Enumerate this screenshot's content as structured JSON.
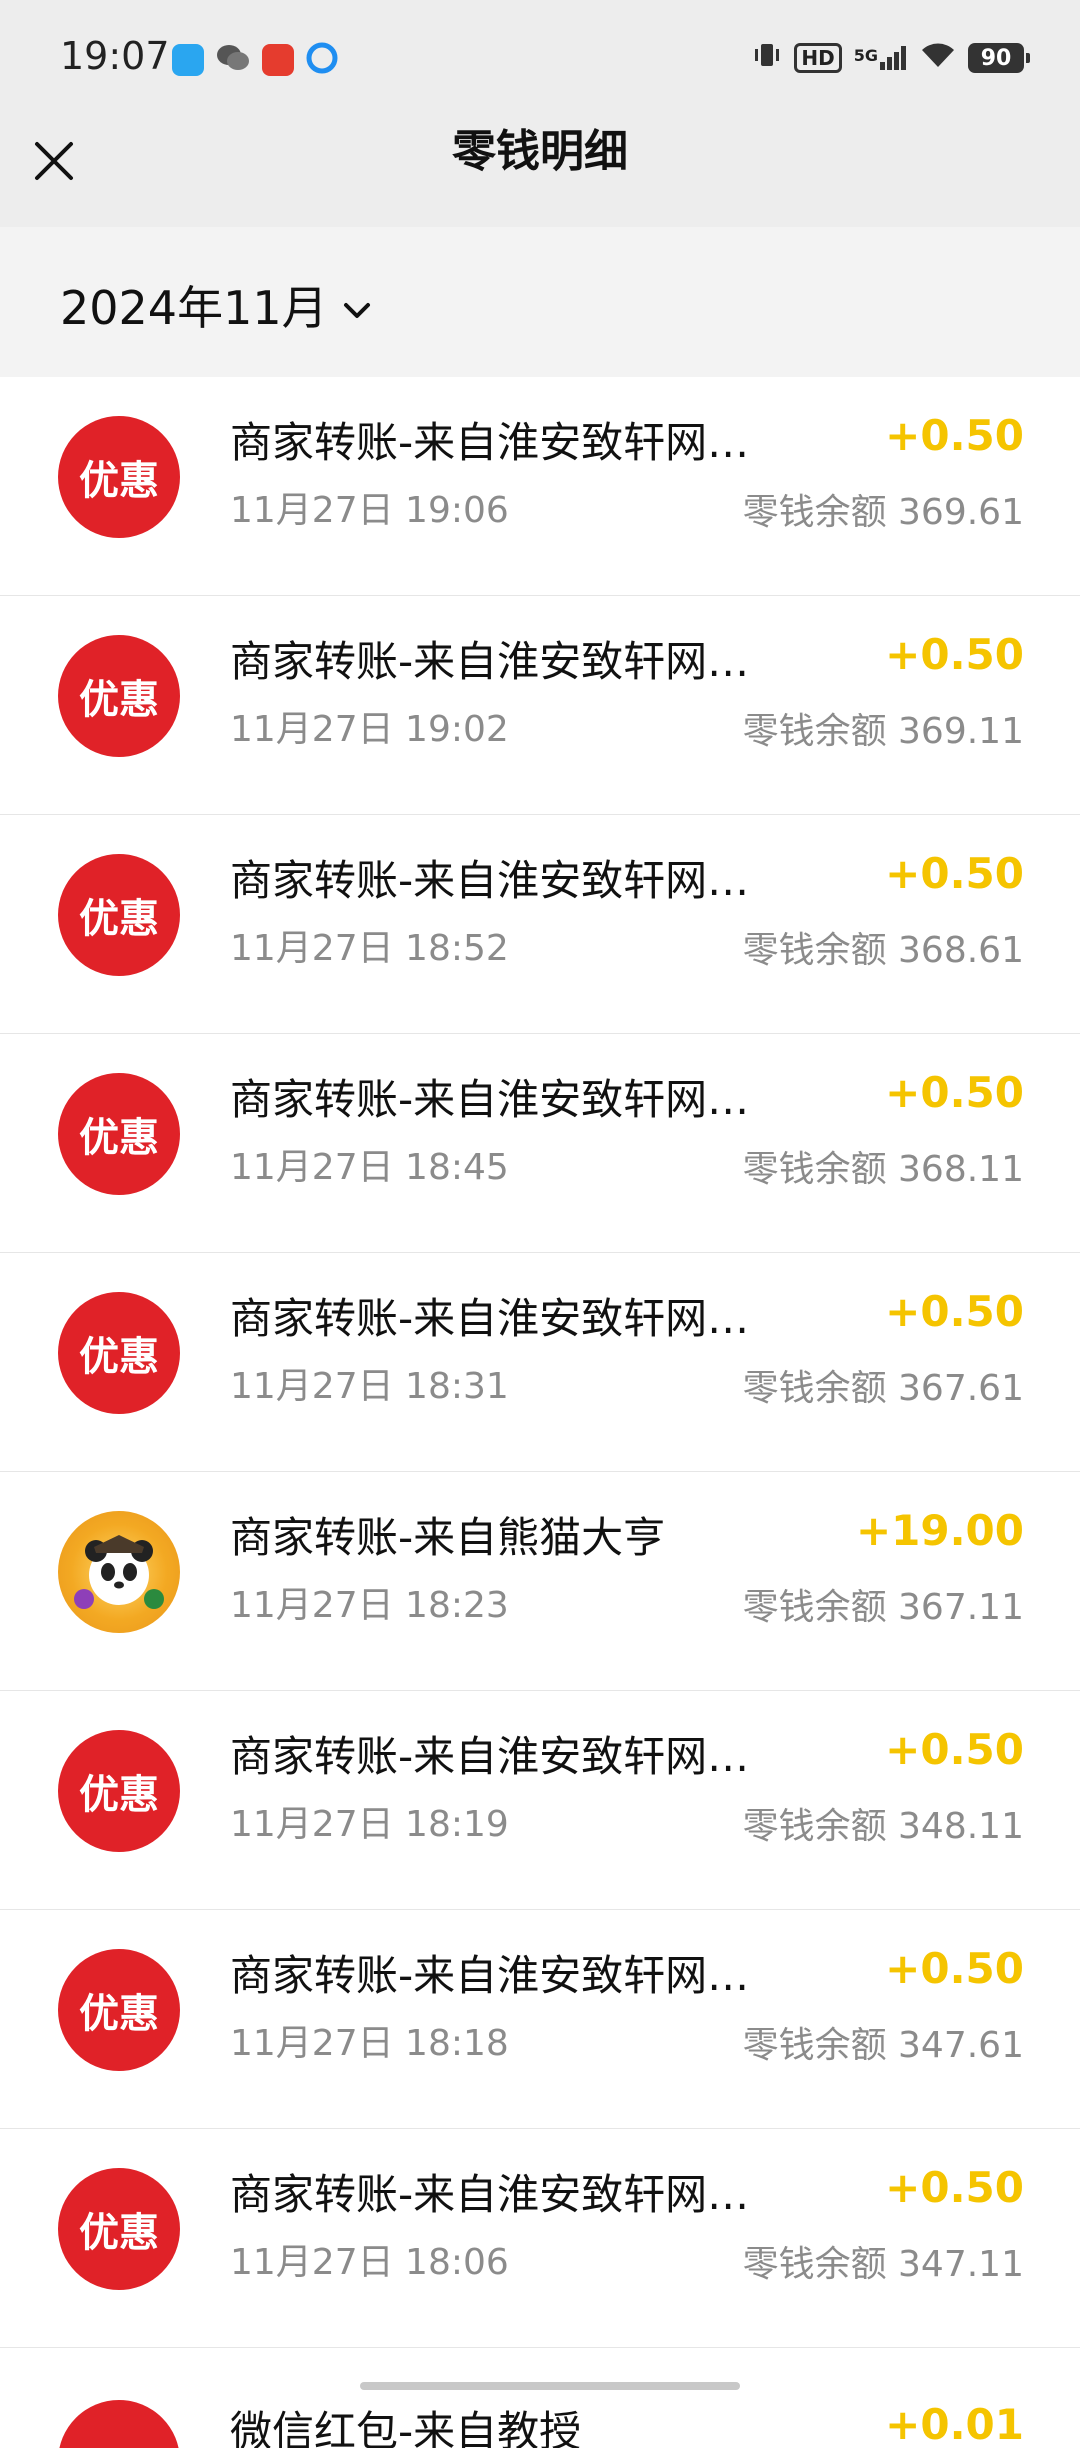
{
  "status_bar": {
    "time": "19:07",
    "network": "5G",
    "hd": "HD",
    "battery": "90"
  },
  "header": {
    "title": "零钱明细"
  },
  "filter": {
    "month": "2024年11月"
  },
  "colors": {
    "amount": "#f5c400",
    "avatar_red": "#e02228",
    "header_bg": "#ededed",
    "month_bg": "#f3f3f3"
  },
  "transactions": [
    {
      "avatar": "优惠",
      "title": "商家转账-来自淮安致轩网…",
      "date": "11月27日 19:06",
      "amount": "+0.50",
      "balance": "零钱余额 369.61"
    },
    {
      "avatar": "优惠",
      "title": "商家转账-来自淮安致轩网…",
      "date": "11月27日 19:02",
      "amount": "+0.50",
      "balance": "零钱余额 369.11"
    },
    {
      "avatar": "优惠",
      "title": "商家转账-来自淮安致轩网…",
      "date": "11月27日 18:52",
      "amount": "+0.50",
      "balance": "零钱余额 368.61"
    },
    {
      "avatar": "优惠",
      "title": "商家转账-来自淮安致轩网…",
      "date": "11月27日 18:45",
      "amount": "+0.50",
      "balance": "零钱余额 368.11"
    },
    {
      "avatar": "优惠",
      "title": "商家转账-来自淮安致轩网…",
      "date": "11月27日 18:31",
      "amount": "+0.50",
      "balance": "零钱余额 367.61"
    },
    {
      "avatar": "",
      "avatar_icon": "panda-avatar-icon",
      "title": "商家转账-来自熊猫大亨",
      "date": "11月27日 18:23",
      "amount": "+19.00",
      "balance": "零钱余额 367.11"
    },
    {
      "avatar": "优惠",
      "title": "商家转账-来自淮安致轩网…",
      "date": "11月27日 18:19",
      "amount": "+0.50",
      "balance": "零钱余额 348.11"
    },
    {
      "avatar": "优惠",
      "title": "商家转账-来自淮安致轩网…",
      "date": "11月27日 18:18",
      "amount": "+0.50",
      "balance": "零钱余额 347.61"
    },
    {
      "avatar": "优惠",
      "title": "商家转账-来自淮安致轩网…",
      "date": "11月27日 18:06",
      "amount": "+0.50",
      "balance": "零钱余额 347.11"
    }
  ],
  "partial_row": {
    "title": "微信红包-来自教授",
    "amount": "+0.01"
  }
}
